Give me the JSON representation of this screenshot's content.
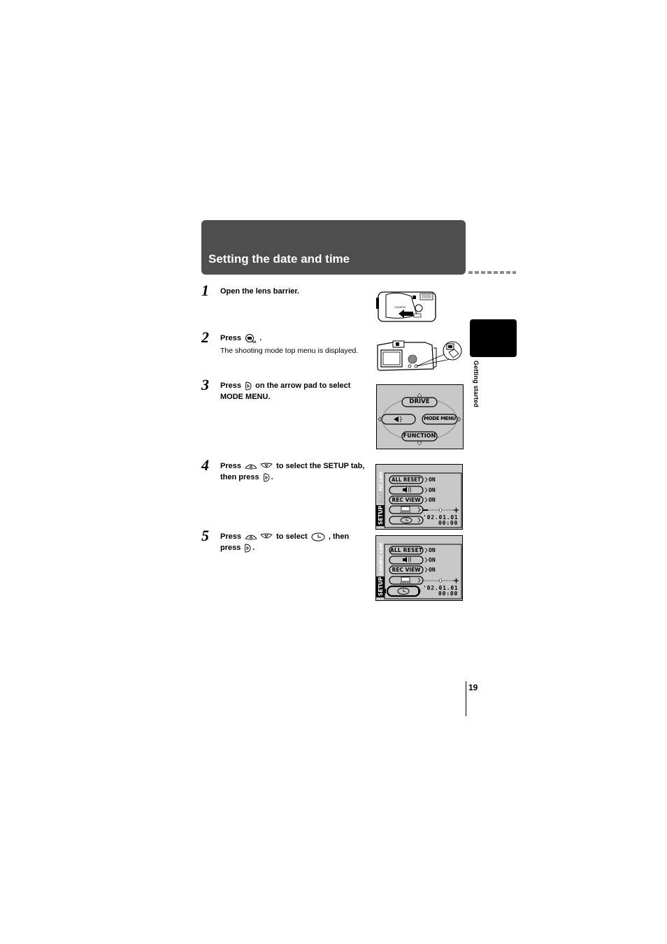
{
  "header": {
    "title": "Setting the date and time"
  },
  "side_tab": {
    "label": "Getting started"
  },
  "steps": [
    {
      "number": "1",
      "text": "Open the lens barrier."
    },
    {
      "number": "2",
      "text_before": "Press",
      "text_after": ".",
      "icon": "monitor-button-icon",
      "sub": "The shooting mode top menu is displayed."
    },
    {
      "number": "3",
      "text_before": "Press",
      "text_after": "on the arrow pad to select MODE MENU.",
      "icon": "arrow-right-button-icon"
    },
    {
      "number": "4",
      "text_before": "Press",
      "text_middle": "to select the SETUP tab, then press",
      "text_after": ".",
      "icons": [
        "arrow-up-button-icon",
        "arrow-down-button-icon",
        "arrow-right-button-icon"
      ]
    },
    {
      "number": "5",
      "text_before": "Press",
      "text_middle": "to select",
      "text_middle2": ", then press",
      "text_after": ".",
      "icons": [
        "arrow-up-button-icon",
        "arrow-down-button-icon",
        "clock-icon",
        "arrow-right-button-icon"
      ]
    }
  ],
  "top_menu_screen": {
    "top": "DRIVE",
    "right": "MODE MENU",
    "bottom": "FUNCTION",
    "left_icon": "flash-icon"
  },
  "setup_menu": {
    "tabs": [
      "CAM",
      "PIC",
      "CARD",
      "SETUP"
    ],
    "active_tab": "SETUP",
    "rows": [
      {
        "label": "ALL RESET",
        "value": "ON"
      },
      {
        "label": "",
        "icon": "speaker-icon",
        "value": "ON"
      },
      {
        "label": "REC VIEW",
        "value": "ON"
      },
      {
        "label": "",
        "icon": "monitor-brightness-icon",
        "value": "slider"
      },
      {
        "label": "",
        "icon": "clock-icon",
        "value_date": "'02.01.01",
        "value_time": "00:00"
      }
    ]
  },
  "page": {
    "number": "19"
  }
}
